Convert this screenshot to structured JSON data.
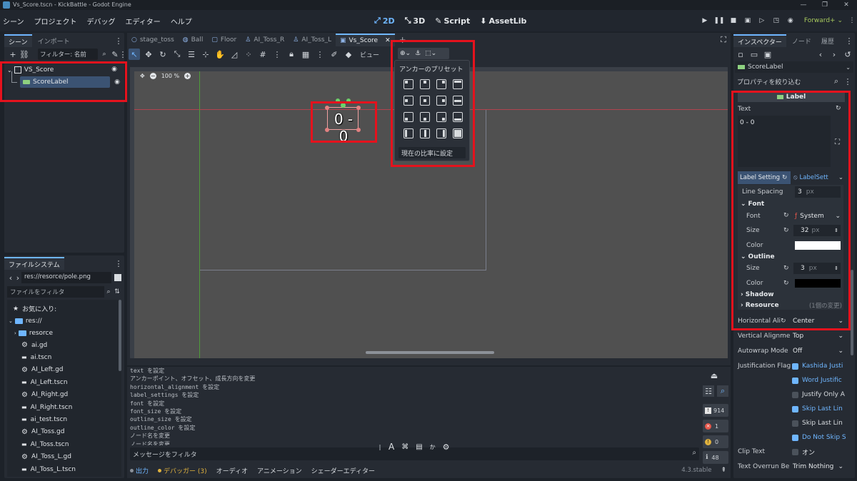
{
  "window": {
    "title": "Vs_Score.tscn - KickBattle - Godot Engine"
  },
  "menu": [
    "シーン",
    "プロジェクト",
    "デバッグ",
    "エディター",
    "ヘルプ"
  ],
  "modes": [
    {
      "label": "2D",
      "active": true
    },
    {
      "label": "3D"
    },
    {
      "label": "Script"
    },
    {
      "label": "AssetLib"
    }
  ],
  "renderer": "Forward+",
  "scene_panel": {
    "tabs": [
      "シーン",
      "インポート"
    ],
    "filter_placeholder": "フィルター: 名前",
    "tree": [
      {
        "label": "VS_Score",
        "icon": "control-node-icon"
      },
      {
        "label": "ScoreLabel",
        "icon": "label-node-icon",
        "selected": true
      }
    ]
  },
  "filesystem": {
    "tab": "ファイルシステム",
    "path": "res://resorce/pole.png",
    "filter_placeholder": "ファイルをフィルタ",
    "favorites": "お気に入り:",
    "root": "res://",
    "folder": "resorce",
    "files": [
      "ai.gd",
      "ai.tscn",
      "AI_Left.gd",
      "AI_Left.tscn",
      "AI_Right.gd",
      "AI_Right.tscn",
      "ai_test.tscn",
      "AI_Toss.gd",
      "AI_Toss.tscn",
      "AI_Toss_L.gd",
      "AI_Toss_L.tscn"
    ]
  },
  "viewport": {
    "tabs": [
      "stage_toss",
      "Ball",
      "Floor",
      "AI_Toss_R",
      "AI_Toss_L",
      "Vs_Score"
    ],
    "active_tab": "Vs_Score",
    "view_label": "ビュー",
    "zoom": "100 %",
    "score_text": "0 - 0"
  },
  "anchor_popup": {
    "title": "アンカーのプリセット",
    "fit_button": "現在の比率に設定"
  },
  "output": {
    "log": [
      "text を設定",
      "アンカーポイント、オフセット、成長方向を変更",
      "horizontal_alignment を設定",
      "label_settings を設定",
      "font を設定",
      "font_size を設定",
      "outline_size を設定",
      "outline_color を設定",
      "ノード名を変更",
      "ノード名を変更"
    ],
    "filter_placeholder": "メッセージをフィルタ",
    "counts": {
      "all": "914",
      "errors": "1",
      "warnings": "0",
      "info": "48"
    },
    "bottom_tabs": [
      "出力",
      "デバッガー (3)",
      "オーディオ",
      "アニメーション",
      "シェーダーエディター"
    ],
    "version": "4.3.stable"
  },
  "inspector": {
    "tabs": [
      "インスペクター",
      "ノード",
      "履歴"
    ],
    "node": "ScoreLabel",
    "filter_placeholder": "プロパティを絞り込む",
    "class_header": "Label",
    "text_label": "Text",
    "text_value": "0 - 0",
    "label_settings_label": "Label Setting",
    "label_settings_value": "LabelSett",
    "line_spacing": {
      "label": "Line Spacing",
      "value": "3",
      "unit": "px"
    },
    "font_section": "Font",
    "font": {
      "label": "Font",
      "value": "System"
    },
    "font_size": {
      "label": "Size",
      "value": "32",
      "unit": "px"
    },
    "font_color": {
      "label": "Color",
      "value": "#ffffff"
    },
    "outline_section": "Outline",
    "outline_size": {
      "label": "Size",
      "value": "3",
      "unit": "px"
    },
    "outline_color": {
      "label": "Color",
      "value": "#000000"
    },
    "shadow_section": "Shadow",
    "resource_section": "Resource",
    "resource_changes": "(1個の変更)",
    "horizontal_alignment": {
      "label": "Horizontal Ali",
      "value": "Center"
    },
    "vertical_alignment": {
      "label": "Vertical Alignme",
      "value": "Top"
    },
    "autowrap": {
      "label": "Autowrap Mode",
      "value": "Off"
    },
    "justification": {
      "label": "Justification Flag",
      "flags": [
        {
          "label": "Kashida Justi",
          "on": true
        },
        {
          "label": "Word Justific",
          "on": true
        },
        {
          "label": "Justify Only A",
          "on": false
        },
        {
          "label": "Skip Last Lin",
          "on": true
        },
        {
          "label": "Skip Last Lin",
          "on": false
        },
        {
          "label": "Do Not Skip S",
          "on": true
        }
      ]
    },
    "clip_text": {
      "label": "Clip Text",
      "value": "オン"
    },
    "overrun": {
      "label": "Text Overrun Be",
      "value": "Trim Nothing"
    }
  },
  "colors": {
    "accent": "#6fb6ff",
    "highlight": "#e5121d",
    "guide_red": "#c0394b",
    "guide_green": "#4f9b3a"
  }
}
